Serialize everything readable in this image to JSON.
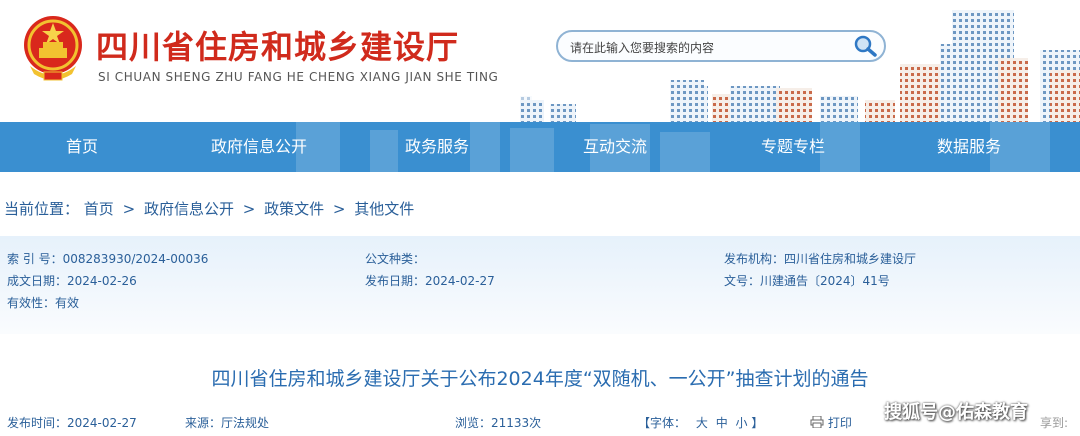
{
  "header": {
    "title_cn": "四川省住房和城乡建设厅",
    "title_en": "SI CHUAN SHENG ZHU FANG HE CHENG XIANG JIAN SHE TING",
    "search_placeholder": "请在此输入您要搜索的内容"
  },
  "nav": {
    "items": [
      "首页",
      "政府信息公开",
      "政务服务",
      "互动交流",
      "专题专栏",
      "数据服务"
    ]
  },
  "breadcrumb": {
    "label": "当前位置：",
    "items": [
      "首页",
      "政府信息公开",
      "政策文件",
      "其他文件"
    ],
    "separator": ">"
  },
  "info": {
    "index_no": "索 引 号：008283930/2024-00036",
    "doc_type": "公文种类：",
    "publisher": "发布机构：四川省住房和城乡建设厅",
    "created": "成文日期：2024-02-26",
    "published": "发布日期：2024-02-27",
    "doc_no": "文号：川建通告〔2024〕41号",
    "validity": "有效性：有效"
  },
  "article": {
    "title": "四川省住房和城乡建设厅关于公布2024年度“双随机、一公开”抽查计划的通告",
    "publish_time": "发布时间：2024-02-27",
    "source": "来源：厅法规处",
    "views": "浏览：21133次",
    "font_label": "【字体：",
    "font_large": "大",
    "font_medium": "中",
    "font_small": "小",
    "font_close": "】",
    "print": "打印",
    "share_partial": "享到:"
  },
  "watermark": "搜狐号@佑森教育",
  "colors": {
    "nav_bg": "#3a8fd0",
    "title_red": "#d02a1c",
    "link_blue": "#2a5f99"
  }
}
